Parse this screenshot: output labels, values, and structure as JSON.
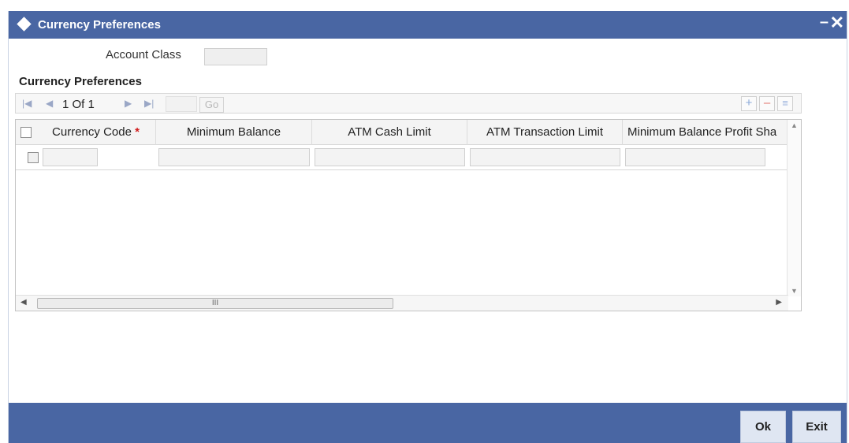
{
  "window": {
    "title": "Currency Preferences",
    "minimize_symbol": "–",
    "close_symbol": "✕"
  },
  "form": {
    "account_class_label": "Account Class",
    "account_class_value": ""
  },
  "section": {
    "heading": "Currency Preferences"
  },
  "pagination": {
    "first_icon": "first-page-icon",
    "prev_icon": "prev-page-icon",
    "next_icon": "next-page-icon",
    "last_icon": "last-page-icon",
    "page_text": "1 Of 1",
    "page_input_value": "",
    "go_label": "Go"
  },
  "toolbar_icons": {
    "add_symbol": "+",
    "delete_symbol": "–",
    "view_symbol": "≡"
  },
  "grid": {
    "columns": [
      {
        "label": "Currency Code",
        "required_marker": "*"
      },
      {
        "label": "Minimum Balance"
      },
      {
        "label": "ATM Cash Limit"
      },
      {
        "label": "ATM Transaction Limit"
      },
      {
        "label": "Minimum Balance Profit Sha"
      }
    ],
    "rows": [
      {
        "currency_code": "",
        "minimum_balance": "",
        "atm_cash_limit": "",
        "atm_transaction_limit": "",
        "min_balance_profit_share": ""
      }
    ],
    "scroll_thumb_grip": "III"
  },
  "footer": {
    "ok_label": "Ok",
    "exit_label": "Exit"
  },
  "colors": {
    "titlebar": "#4966a3",
    "footer": "#4966a3",
    "required": "#d01b1b",
    "button_bg": "#dfe6f2"
  }
}
